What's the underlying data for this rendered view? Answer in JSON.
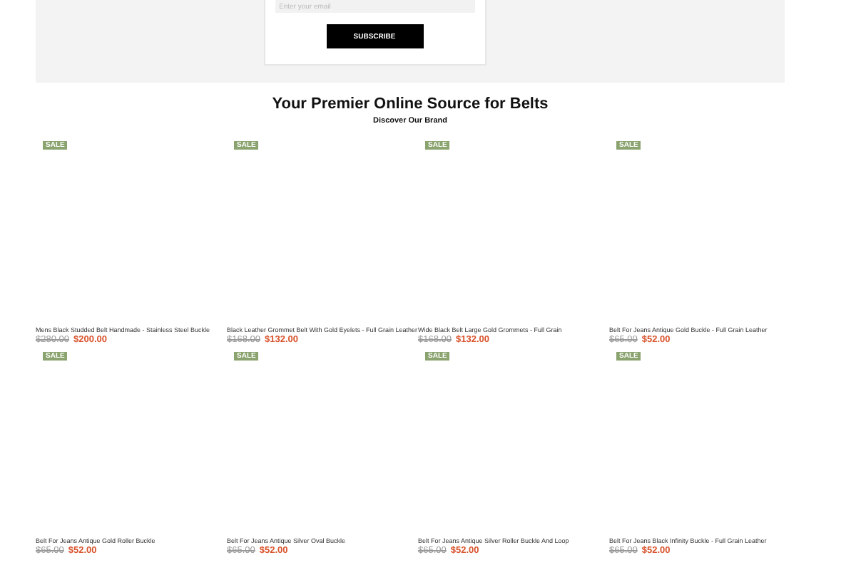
{
  "newsletter": {
    "email_placeholder": "Enter your email",
    "button": "SUBSCRIBE"
  },
  "heading": "Your Premier Online Source for Belts",
  "subheading": "Discover Our Brand",
  "products": [
    {
      "badge": "SALE",
      "title": "Mens Black Studded Belt Handmade - Stainless Steel Buckle",
      "old_price": "$280.00",
      "price": "$200.00"
    },
    {
      "badge": "SALE",
      "title": "Black Leather Grommet Belt With Gold Eyelets - Full Grain Leather",
      "old_price": "$168.00",
      "price": "$132.00"
    },
    {
      "badge": "SALE",
      "title": "Wide Black Belt Large Gold Grommets - Full Grain",
      "old_price": "$168.00",
      "price": "$132.00"
    },
    {
      "badge": "SALE",
      "title": "Belt For Jeans Antique Gold Buckle - Full Grain Leather",
      "old_price": "$65.00",
      "price": "$52.00"
    },
    {
      "badge": "SALE",
      "title": "Belt For Jeans Antique Gold Roller Buckle",
      "old_price": "$65.00",
      "price": "$52.00"
    },
    {
      "badge": "SALE",
      "title": "Belt For Jeans Antique Silver Oval Buckle",
      "old_price": "$65.00",
      "price": "$52.00"
    },
    {
      "badge": "SALE",
      "title": "Belt For Jeans Antique Silver Roller Buckle And Loop",
      "old_price": "$65.00",
      "price": "$52.00"
    },
    {
      "badge": "SALE",
      "title": "Belt For Jeans Black Infinity Buckle - Full Grain Leather",
      "old_price": "$65.00",
      "price": "$52.00"
    }
  ]
}
